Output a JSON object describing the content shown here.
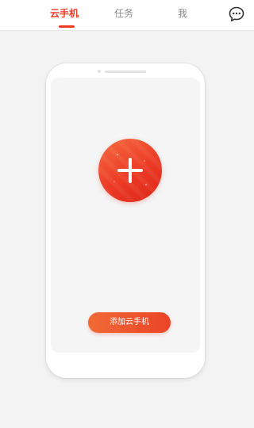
{
  "tabs": [
    {
      "label": "云手机",
      "active": true
    },
    {
      "label": "任务",
      "active": false
    },
    {
      "label": "我",
      "active": false
    }
  ],
  "header": {
    "message_icon": "chat-bubble-icon"
  },
  "phone": {
    "add_icon": "plus-icon",
    "add_button_label": "添加云手机"
  },
  "colors": {
    "accent": "#ef3b24",
    "inactive_tab": "#8a8a8a",
    "background": "#f3f3f3"
  }
}
